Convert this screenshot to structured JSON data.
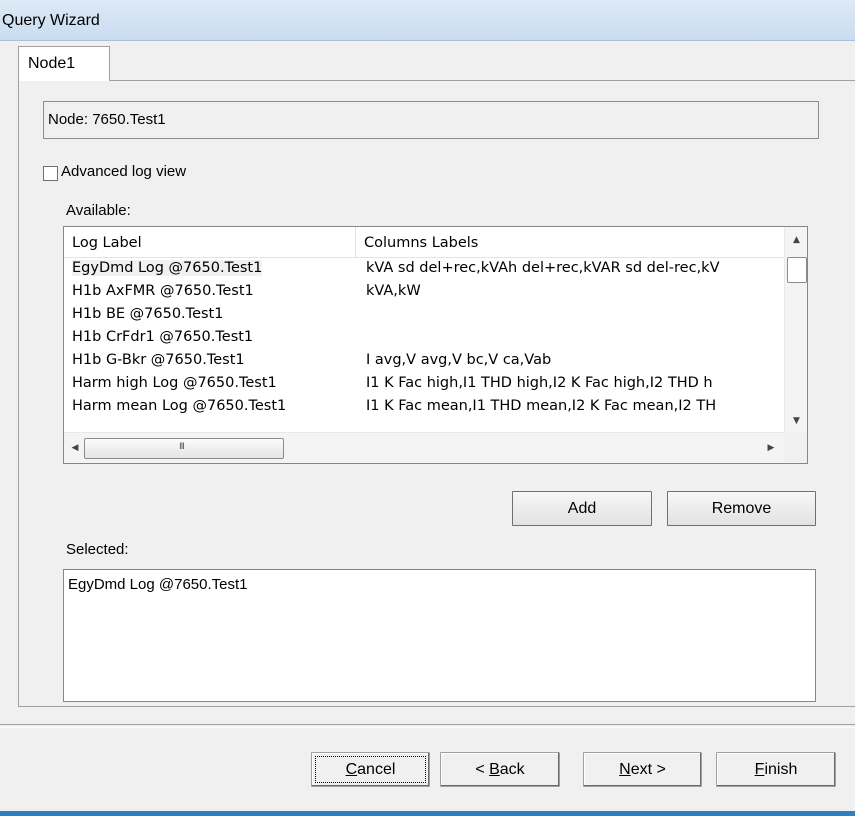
{
  "window": {
    "title": "Query Wizard"
  },
  "tabs": [
    {
      "label": "Node1"
    }
  ],
  "node_field": {
    "value": "Node: 7650.Test1"
  },
  "advanced_log_view": {
    "label": "Advanced log view",
    "checked": false
  },
  "available": {
    "label": "Available:",
    "columns": [
      "Log Label",
      "Columns Labels"
    ],
    "rows": [
      {
        "log_label": "EgyDmd Log @7650.Test1",
        "columns_labels": "kVA sd del+rec,kVAh del+rec,kVAR sd del-rec,kV",
        "selected": true
      },
      {
        "log_label": "H1b AxFMR @7650.Test1",
        "columns_labels": "kVA,kW"
      },
      {
        "log_label": "H1b BE @7650.Test1",
        "columns_labels": ""
      },
      {
        "log_label": "H1b CrFdr1 @7650.Test1",
        "columns_labels": ""
      },
      {
        "log_label": "H1b G-Bkr @7650.Test1",
        "columns_labels": "I avg,V avg,V bc,V ca,Vab"
      },
      {
        "log_label": "Harm high Log @7650.Test1",
        "columns_labels": "I1 K Fac high,I1 THD high,I2 K Fac high,I2 THD h"
      },
      {
        "log_label": "Harm mean Log @7650.Test1",
        "columns_labels": "I1 K Fac mean,I1 THD mean,I2 K Fac mean,I2 TH"
      }
    ]
  },
  "buttons": {
    "add": "Add",
    "remove": "Remove",
    "cancel": {
      "prefix": "",
      "mnemonic": "C",
      "rest": "ancel"
    },
    "back": {
      "prefix": "< ",
      "mnemonic": "B",
      "rest": "ack"
    },
    "next": {
      "prefix": "",
      "mnemonic": "N",
      "rest": "ext >"
    },
    "finish": {
      "prefix": "",
      "mnemonic": "F",
      "rest": "inish"
    }
  },
  "selected": {
    "label": "Selected:",
    "items": [
      "EgyDmd Log @7650.Test1"
    ]
  },
  "icons": {
    "scroll_up": "▲",
    "scroll_down": "▼",
    "scroll_left": "◀",
    "scroll_right": "▶",
    "grip": "III"
  }
}
